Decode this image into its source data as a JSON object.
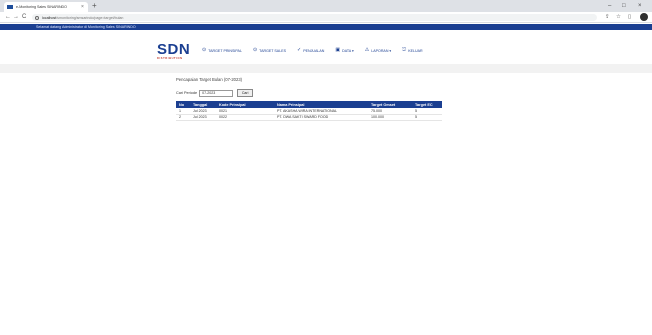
{
  "browser": {
    "tab_title": "e-Monitoring Sales SINARINDO",
    "tab_close": "×",
    "new_tab": "+",
    "url_host": "localhost",
    "url_path": "/smonitoring/smsarindo/page=target/bulan",
    "minimize": "–",
    "maximize": "□",
    "close": "×",
    "back": "←",
    "forward": "→",
    "reload": "C",
    "share_icon": "⇪",
    "star_icon": "☆",
    "sidebar_icon": "▯"
  },
  "appbar": {
    "title": "Selamat datang Administrator di Monitoring Sales SINARINDO"
  },
  "logo": {
    "main": "SDN",
    "sub": "DISTRIBUTION"
  },
  "menu": [
    {
      "icon": "⊙",
      "label": "TARGET PRINSIPAL"
    },
    {
      "icon": "⊙",
      "label": "TARGET SALES"
    },
    {
      "icon": "✓",
      "label": "PENJUALAN"
    },
    {
      "icon": "▣",
      "label": "DATA ▾"
    },
    {
      "icon": "⚠",
      "label": "LAPORAN ▾"
    },
    {
      "icon": "⎋",
      "label": "KELUAR"
    }
  ],
  "page": {
    "title": "Pencapaian Target Bulan (07-2023)"
  },
  "search": {
    "label": "Cari Periode",
    "value": "07-2023",
    "button": "Cari"
  },
  "table": {
    "headers": [
      "No",
      "Tanggal",
      "Kode Prinsipal",
      "Nama Prinsipal",
      "Target Omset",
      "Target EC"
    ],
    "rows": [
      [
        "1",
        "Jul 2023",
        "0021",
        "PT. AKASHA WIRA INTERNATIONAL",
        "75.000",
        "5"
      ],
      [
        "2",
        "Jul 2023",
        "0022",
        "PT. DWA SAKTI SWARD FOOD",
        "100.000",
        "5"
      ]
    ]
  }
}
